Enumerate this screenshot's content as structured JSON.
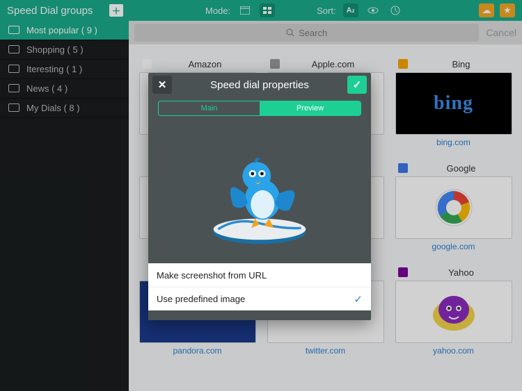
{
  "topbar": {
    "title": "Speed Dial groups",
    "mode_label": "Mode:",
    "sort_label": "Sort:"
  },
  "search": {
    "placeholder": "Search",
    "cancel": "Cancel"
  },
  "sidebar": {
    "groups": [
      {
        "label": "Most popular ( 9 )",
        "active": true
      },
      {
        "label": "Shopping ( 5 )"
      },
      {
        "label": "Iteresting ( 1 )"
      },
      {
        "label": "News ( 4 )"
      },
      {
        "label": "My Dials ( 8 )"
      }
    ]
  },
  "tiles": [
    {
      "name": "Amazon",
      "caption": "",
      "fav": "amazon"
    },
    {
      "name": "Apple.com",
      "caption": "",
      "fav": "apple"
    },
    {
      "name": "Bing",
      "caption": "bing.com",
      "fav": "bing"
    },
    {
      "name": "",
      "caption": "",
      "fav": ""
    },
    {
      "name": "",
      "caption": "",
      "fav": ""
    },
    {
      "name": "Google",
      "caption": "google.com",
      "fav": "google"
    },
    {
      "name": "",
      "caption": "pandora.com",
      "fav": "pandora"
    },
    {
      "name": "",
      "caption": "twitter.com",
      "fav": "twitter"
    },
    {
      "name": "Yahoo",
      "caption": "yahoo.com",
      "fav": "yahoo"
    }
  ],
  "modal": {
    "title": "Speed dial properties",
    "tabs": {
      "main": "Main",
      "preview": "Preview",
      "active": "preview"
    },
    "options": {
      "screenshot": "Make screenshot from URL",
      "predefined": "Use predefined image",
      "selected": "predefined"
    }
  }
}
